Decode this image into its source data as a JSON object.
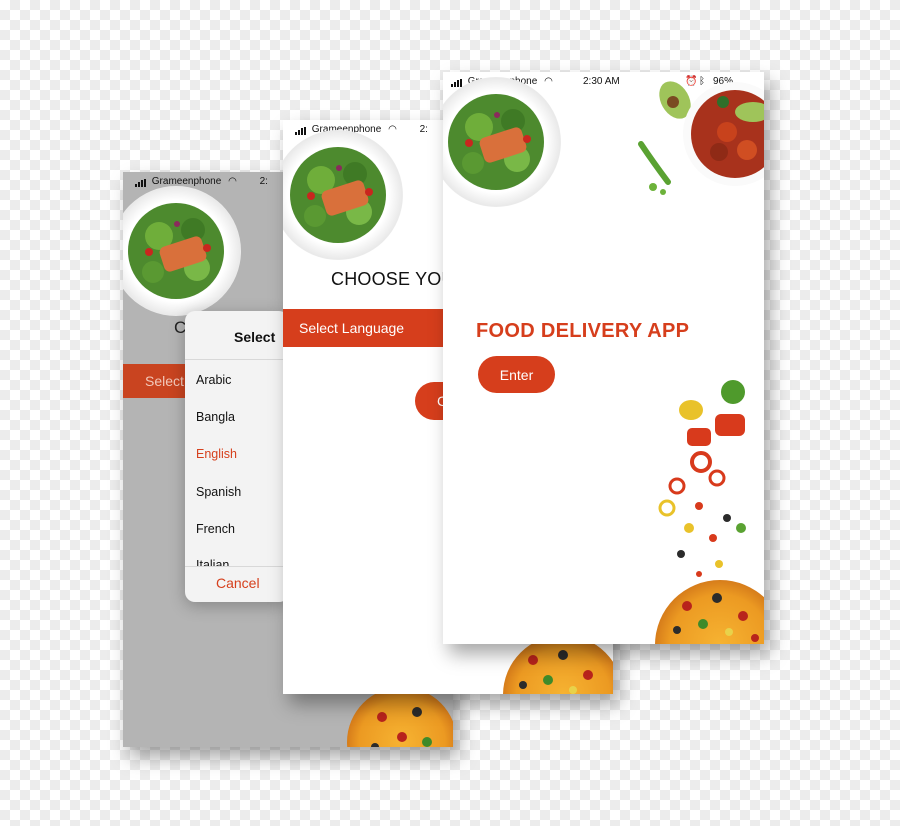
{
  "colors": {
    "accent": "#d63e1c",
    "screen_gray": "#b4b4b4",
    "cancel": "#d6401d"
  },
  "screen1": {
    "status": {
      "carrier": "Grameenphone",
      "time": "2:"
    },
    "heading_partial": "C",
    "ribbon_label": "Select",
    "picker": {
      "title": "Select",
      "items": [
        {
          "label": "Arabic",
          "selected": false
        },
        {
          "label": "Bangla",
          "selected": false
        },
        {
          "label": "English",
          "selected": true
        },
        {
          "label": "Spanish",
          "selected": false
        },
        {
          "label": "French",
          "selected": false
        },
        {
          "label": "Italian",
          "selected": false
        }
      ],
      "cancel_label": "Cancel"
    }
  },
  "screen2": {
    "status": {
      "carrier": "Grameenphone",
      "time": "2:"
    },
    "heading": "CHOOSE YOU",
    "select_label": "Select Language",
    "button_partial": "C"
  },
  "screen3": {
    "status": {
      "carrier": "Grameenphone",
      "time": "2:30 AM",
      "battery": "96%"
    },
    "title": "FOOD DELIVERY APP",
    "enter_label": "Enter"
  }
}
